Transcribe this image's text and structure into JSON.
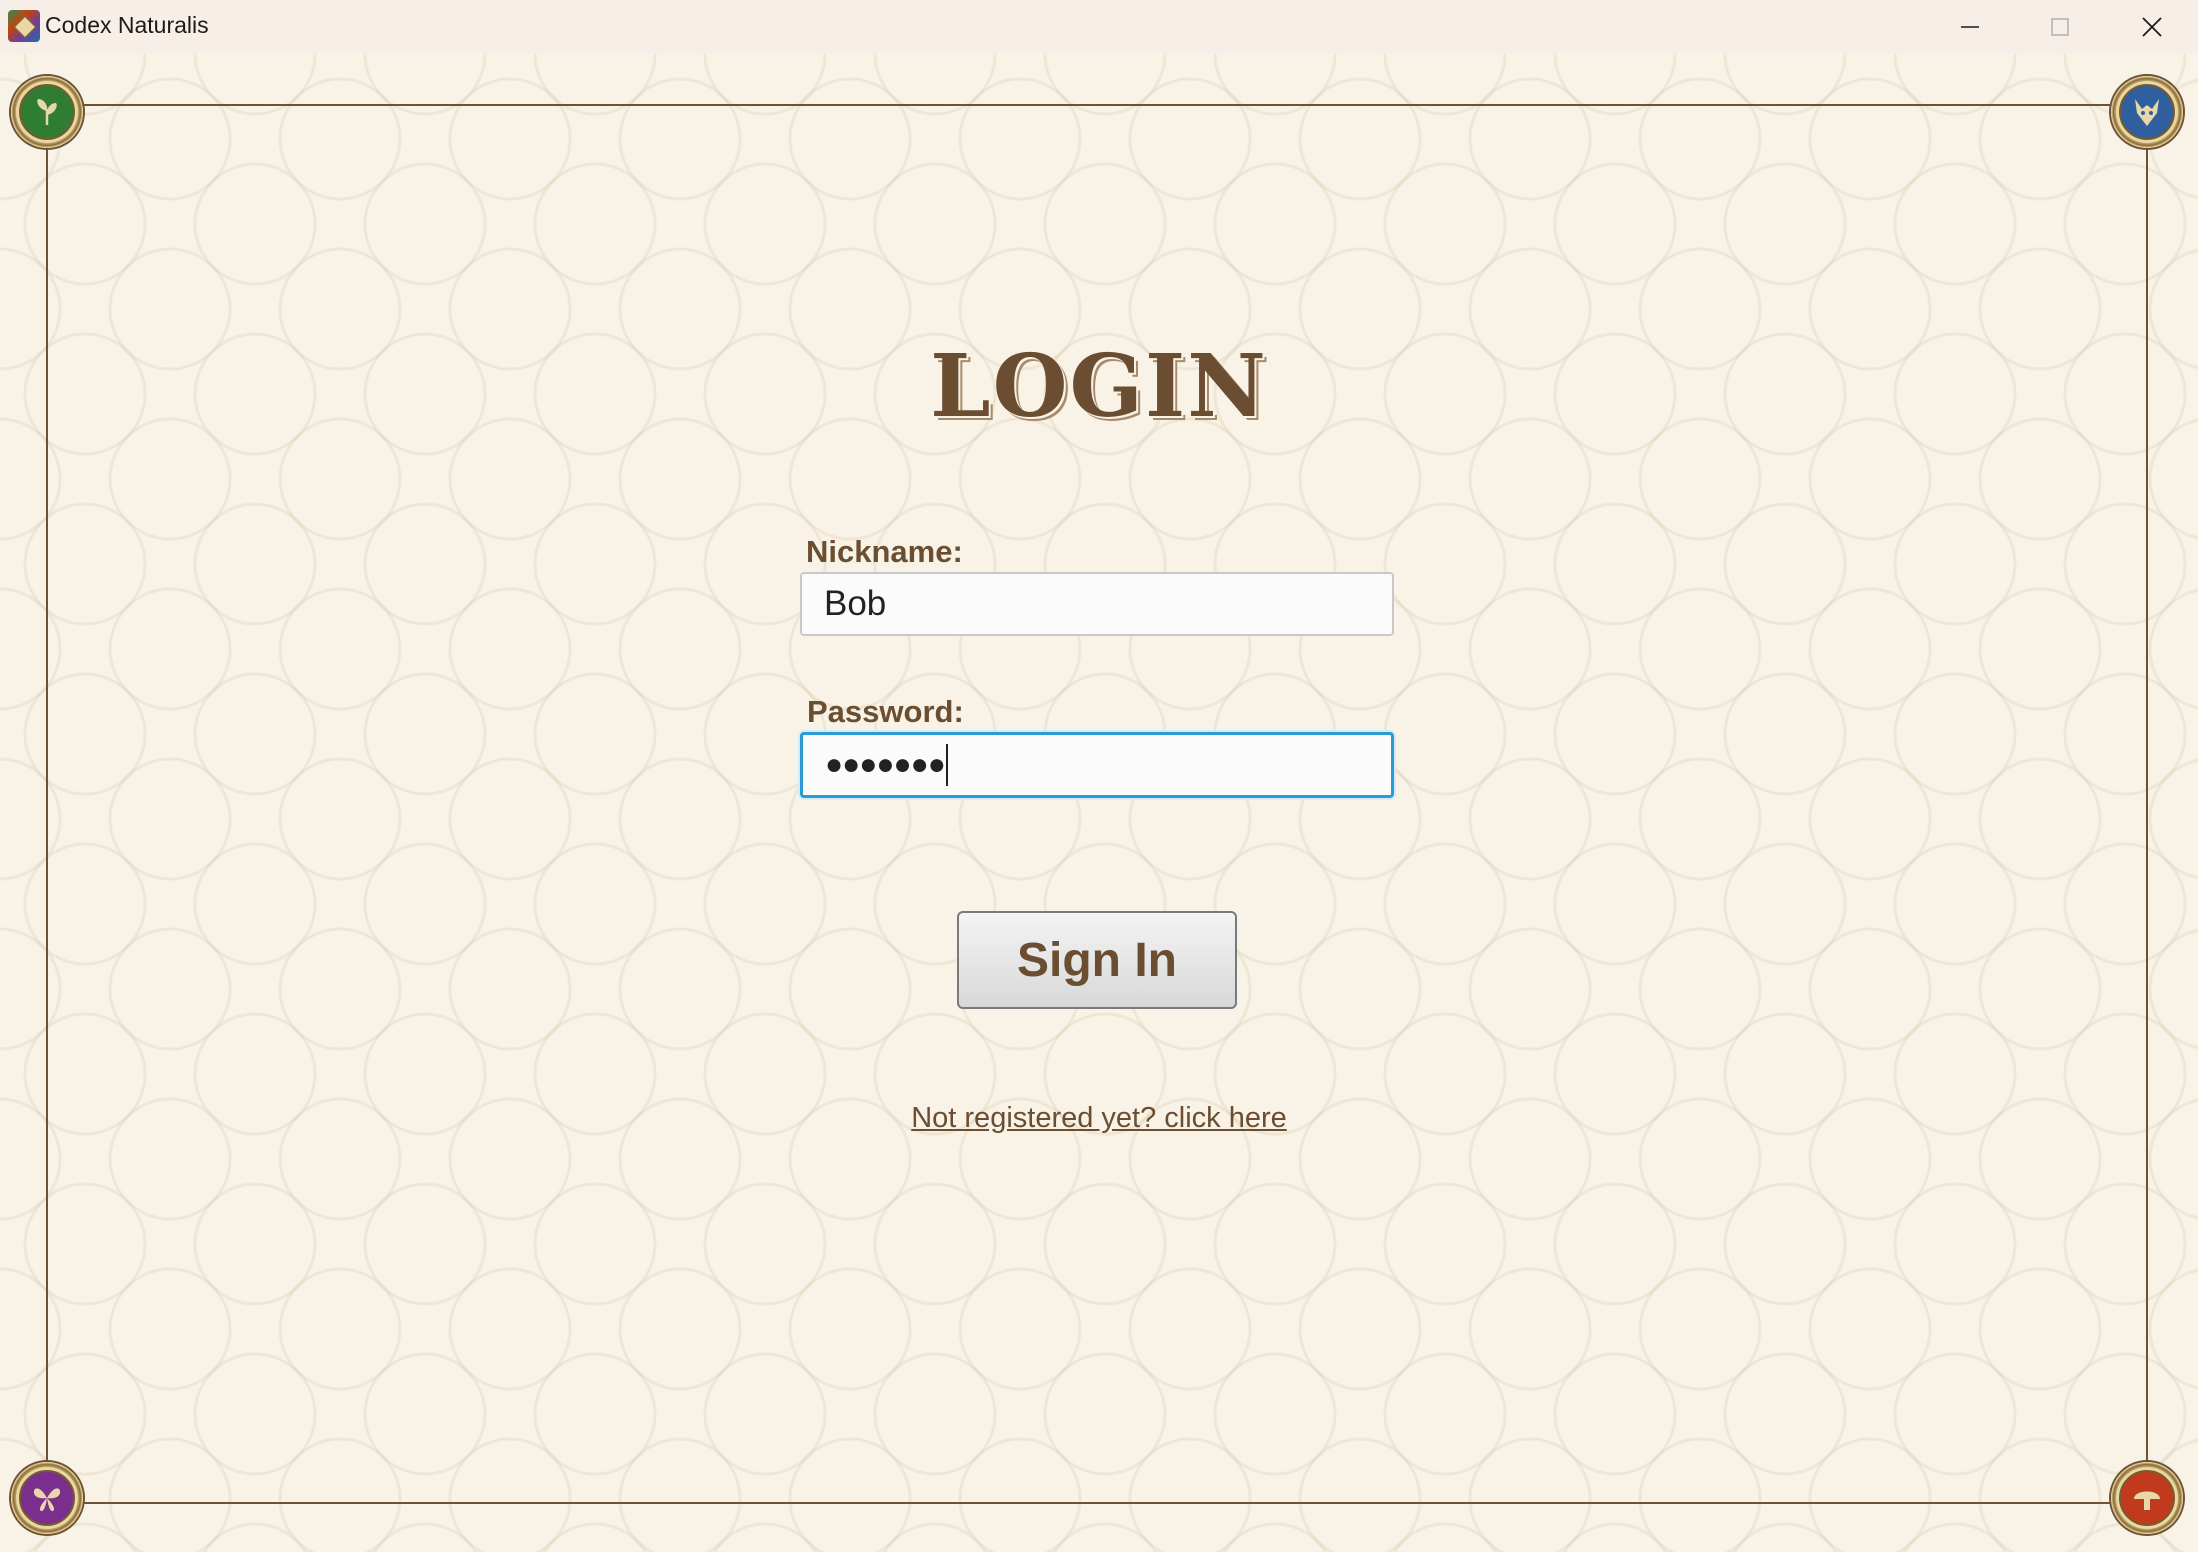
{
  "window": {
    "title": "Codex Naturalis",
    "controls": {
      "minimize": "minimize-icon",
      "maximize": "maximize-icon",
      "close": "close-icon"
    }
  },
  "login": {
    "title": "LOGIN",
    "nickname_label": "Nickname:",
    "nickname_value": "Bob",
    "password_label": "Password:",
    "password_value": "●●●●●●●",
    "sign_in_label": "Sign In",
    "register_link": "Not registered yet? click here"
  },
  "corners": {
    "top_left": "plant-kingdom-icon",
    "top_right": "animal-kingdom-icon",
    "bottom_left": "insect-kingdom-icon",
    "bottom_right": "fungi-kingdom-icon"
  },
  "colors": {
    "background": "#f8f3e6",
    "text_brown": "#6b4e32",
    "focus_blue": "#2b9bd6"
  }
}
